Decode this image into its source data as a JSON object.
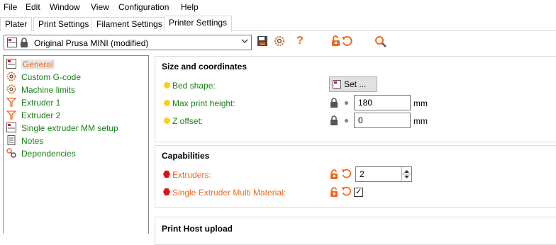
{
  "menu": [
    "File",
    "Edit",
    "Window",
    "View",
    "Configuration",
    "Help"
  ],
  "tabs": [
    {
      "label": "Plater",
      "active": false
    },
    {
      "label": "Print Settings",
      "active": false
    },
    {
      "label": "Filament Settings",
      "active": false
    },
    {
      "label": "Printer Settings",
      "active": true
    }
  ],
  "toolbar": {
    "preset": "Original Prusa MINI (modified)",
    "icons": [
      "save-icon",
      "gear-icon",
      "question-icon",
      "unlock-icon",
      "undo-arrow-icon",
      "search-icon"
    ],
    "help_glyph": "?"
  },
  "tree": {
    "items": [
      {
        "label": "General",
        "icon": "printer-icon",
        "selected": true
      },
      {
        "label": "Custom G-code",
        "icon": "gear-icon",
        "selected": false
      },
      {
        "label": "Machine limits",
        "icon": "gear-icon",
        "selected": false
      },
      {
        "label": "Extruder 1",
        "icon": "funnel-icon",
        "selected": false
      },
      {
        "label": "Extruder 2",
        "icon": "funnel-icon",
        "selected": false
      },
      {
        "label": "Single extruder MM setup",
        "icon": "printer-icon",
        "selected": false
      },
      {
        "label": "Notes",
        "icon": "note-icon",
        "selected": false
      },
      {
        "label": "Dependencies",
        "icon": "wrench-icon",
        "selected": false
      }
    ]
  },
  "size_section": {
    "title": "Size and coordinates",
    "bed_shape_label": "Bed shape:",
    "bed_shape_button": "Set ...",
    "max_height_label": "Max print height:",
    "max_height_value": "180",
    "max_height_unit": "mm",
    "z_offset_label": "Z offset:",
    "z_offset_value": "0",
    "z_offset_unit": "mm"
  },
  "capabilities_section": {
    "title": "Capabilities",
    "extruders_label": "Extruders:",
    "extruders_value": "2",
    "single_mm_label": "Single Extruder Multi Material:",
    "single_mm_checked": true,
    "check_glyph": "✓"
  },
  "print_host_section": {
    "title": "Print Host upload"
  },
  "colors": {
    "accent_orange": "#ed6b21",
    "label_green": "#197e19",
    "system_yellow": "#f5d21a",
    "modified_red": "#d81416"
  }
}
